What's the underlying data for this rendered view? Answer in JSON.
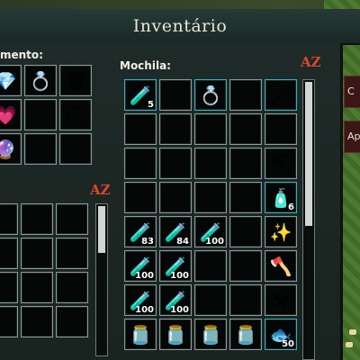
{
  "window": {
    "title": "Inventário"
  },
  "equipment": {
    "label": "mento:"
  },
  "backpack": {
    "label": "Mochila:"
  },
  "sort_label": "AZ",
  "side_buttons": [
    {
      "label": "C"
    },
    {
      "label": "Ap"
    }
  ],
  "equipment_slots": [
    {
      "icon": "💎",
      "icon_name": "ring-icon",
      "qty": ""
    },
    {
      "icon": "💍",
      "icon_name": "ring-icon",
      "qty": ""
    },
    {
      "icon": "🗑",
      "icon_name": "trash-icon",
      "qty": ""
    },
    {
      "icon": "💗",
      "icon_name": "amulet-icon",
      "qty": ""
    },
    {
      "icon": "",
      "icon_name": "",
      "qty": ""
    },
    {
      "icon": "⛏",
      "icon_name": "pickaxe-icon",
      "qty": ""
    },
    {
      "icon": "🔮",
      "icon_name": "gem-icon",
      "qty": ""
    },
    {
      "icon": "",
      "icon_name": "",
      "qty": ""
    },
    {
      "icon": "",
      "icon_name": "",
      "qty": ""
    }
  ],
  "backpack_slots": [
    {
      "icon": "🧪",
      "icon_name": "mana-potion-icon",
      "qty": "5"
    },
    {
      "icon": "",
      "icon_name": "",
      "qty": ""
    },
    {
      "icon": "💍",
      "icon_name": "ring-icon",
      "qty": ""
    },
    {
      "icon": "",
      "icon_name": "",
      "qty": ""
    },
    {
      "icon": "🗡",
      "icon_name": "weapon-icon",
      "qty": ""
    },
    {
      "icon": "",
      "icon_name": "",
      "qty": ""
    },
    {
      "icon": "",
      "icon_name": "",
      "qty": ""
    },
    {
      "icon": "",
      "icon_name": "",
      "qty": ""
    },
    {
      "icon": "",
      "icon_name": "",
      "qty": ""
    },
    {
      "icon": "",
      "icon_name": "",
      "qty": ""
    },
    {
      "icon": "",
      "icon_name": "",
      "qty": ""
    },
    {
      "icon": "",
      "icon_name": "",
      "qty": ""
    },
    {
      "icon": "",
      "icon_name": "",
      "qty": ""
    },
    {
      "icon": "",
      "icon_name": "",
      "qty": ""
    },
    {
      "icon": "⛏",
      "icon_name": "pickaxe-icon",
      "qty": ""
    },
    {
      "icon": "",
      "icon_name": "",
      "qty": ""
    },
    {
      "icon": "",
      "icon_name": "",
      "qty": ""
    },
    {
      "icon": "",
      "icon_name": "",
      "qty": ""
    },
    {
      "icon": "",
      "icon_name": "",
      "qty": ""
    },
    {
      "icon": "🧴",
      "icon_name": "mana-potion-icon",
      "qty": "6"
    },
    {
      "icon": "🧪",
      "icon_name": "health-potion-icon",
      "qty": "83"
    },
    {
      "icon": "🧪",
      "icon_name": "health-potion-icon",
      "qty": "84"
    },
    {
      "icon": "🧪",
      "icon_name": "health-potion-icon",
      "qty": "100"
    },
    {
      "icon": "",
      "icon_name": "",
      "qty": ""
    },
    {
      "icon": "✨",
      "icon_name": "wand-icon",
      "qty": ""
    },
    {
      "icon": "🧪",
      "icon_name": "health-potion-icon",
      "qty": "100"
    },
    {
      "icon": "🧪",
      "icon_name": "health-potion-icon",
      "qty": "100"
    },
    {
      "icon": "",
      "icon_name": "",
      "qty": ""
    },
    {
      "icon": "",
      "icon_name": "",
      "qty": ""
    },
    {
      "icon": "🪓",
      "icon_name": "axe-icon",
      "qty": ""
    },
    {
      "icon": "🧪",
      "icon_name": "health-potion-icon",
      "qty": "100"
    },
    {
      "icon": "🧪",
      "icon_name": "health-potion-icon",
      "qty": "100"
    },
    {
      "icon": "",
      "icon_name": "",
      "qty": ""
    },
    {
      "icon": "",
      "icon_name": "",
      "qty": ""
    },
    {
      "icon": "⚒",
      "icon_name": "shovel-icon",
      "qty": ""
    },
    {
      "icon": "🫙",
      "icon_name": "mana-potion-icon",
      "qty": ""
    },
    {
      "icon": "🫙",
      "icon_name": "mana-potion-icon",
      "qty": ""
    },
    {
      "icon": "🫙",
      "icon_name": "mana-potion-icon",
      "qty": ""
    },
    {
      "icon": "🫙",
      "icon_name": "mana-potion-icon",
      "qty": ""
    },
    {
      "icon": "🐟",
      "icon_name": "fish-icon",
      "qty": "50"
    }
  ],
  "storage_slots": 12,
  "colors": {
    "sort_accent": "#e0462a",
    "slot_border": "#8a9a9b",
    "highlight": "#2fb3c9"
  }
}
